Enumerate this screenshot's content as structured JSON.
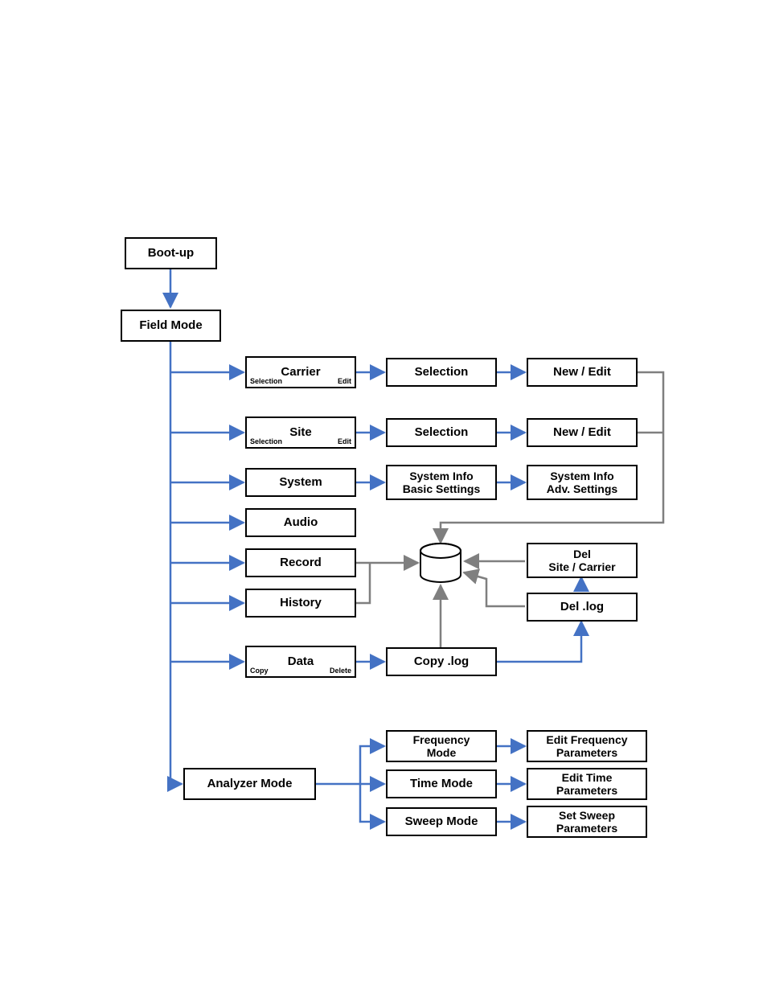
{
  "nodes": {
    "bootup": "Boot-up",
    "fieldmode": "Field Mode",
    "carrier": {
      "label": "Carrier",
      "left": "Selection",
      "right": "Edit"
    },
    "carrier_sel": "Selection",
    "carrier_new": "New / Edit",
    "site": {
      "label": "Site",
      "left": "Selection",
      "right": "Edit"
    },
    "site_sel": "Selection",
    "site_new": "New / Edit",
    "system": "System",
    "system_basic": "System Info\nBasic Settings",
    "system_adv": "System Info\nAdv. Settings",
    "audio": "Audio",
    "record": "Record",
    "history": "History",
    "data": {
      "label": "Data",
      "left": "Copy",
      "right": "Delete"
    },
    "copylog": "Copy .log",
    "dellog": "Del .log",
    "delsite": "Del\nSite / Carrier",
    "analyzer": "Analyzer  Mode",
    "freqmode": "Frequency\nMode",
    "timemode": "Time Mode",
    "sweepmode": "Sweep Mode",
    "editfreq": "Edit Frequency\nParameters",
    "edittime": "Edit Time\nParameters",
    "setsweep": "Set Sweep\nParameters"
  }
}
